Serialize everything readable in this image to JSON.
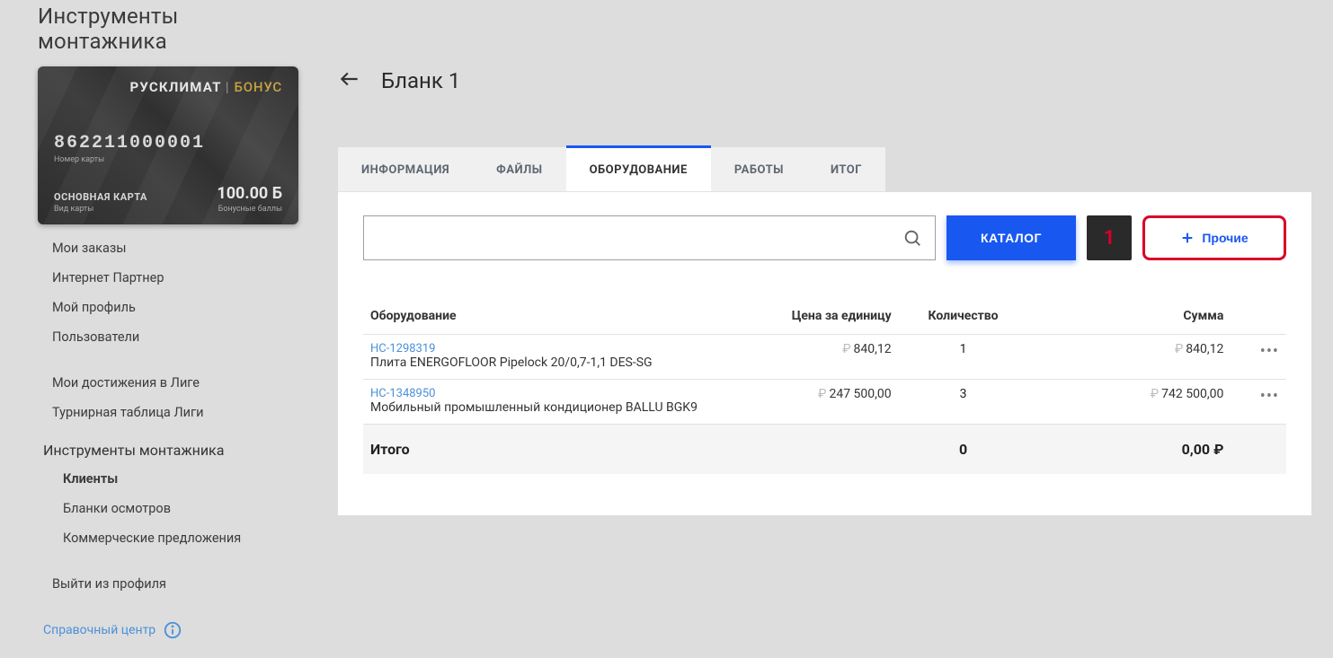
{
  "sidebar": {
    "title": "Инструменты монтажника",
    "card": {
      "brand_main": "РУСКЛИМАТ",
      "brand_sub": "БОНУС",
      "number": "862211000001",
      "number_label": "Номер карты",
      "type": "ОСНОВНАЯ КАРТА",
      "type_label": "Вид карты",
      "balance": "100.00 Б",
      "balance_label": "Бонусные баллы"
    },
    "nav": [
      {
        "label": "Мои заказы"
      },
      {
        "label": "Интернет Партнер"
      },
      {
        "label": "Мой профиль"
      },
      {
        "label": "Пользователи"
      }
    ],
    "nav2": [
      {
        "label": "Мои достижения в Лиге"
      },
      {
        "label": "Турнирная таблица Лиги"
      }
    ],
    "section_head": "Инструменты монтажника",
    "nav3": [
      {
        "label": "Клиенты",
        "active": true
      },
      {
        "label": "Бланки осмотров"
      },
      {
        "label": "Коммерческие предложения"
      }
    ],
    "logout": "Выйти из профиля",
    "help": "Справочный центр"
  },
  "page": {
    "title": "Бланк 1",
    "tabs": [
      {
        "label": "ИНФОРМАЦИЯ"
      },
      {
        "label": "ФАЙЛЫ"
      },
      {
        "label": "ОБОРУДОВАНИЕ",
        "active": true
      },
      {
        "label": "РАБОТЫ"
      },
      {
        "label": "ИТОГ"
      }
    ],
    "actions": {
      "catalog": "КАТАЛОГ",
      "other": "Прочие",
      "annotation": "1"
    },
    "table": {
      "headers": {
        "equipment": "Оборудование",
        "unit_price": "Цена за единицу",
        "qty": "Количество",
        "sum": "Сумма"
      },
      "rows": [
        {
          "sku": "НС-1298319",
          "desc": "Плита ENERGOFLOOR Pipelock 20/0,7-1,1 DES-SG",
          "unit_price": "840,12",
          "qty": "1",
          "sum": "840,12"
        },
        {
          "sku": "НС-1348950",
          "desc": "Мобильный промышленный кондиционер BALLU BGK9",
          "unit_price": "247 500,00",
          "qty": "3",
          "sum": "742 500,00"
        }
      ],
      "total_label": "Итого",
      "total_qty": "0",
      "total_sum": "0,00 ₽"
    }
  }
}
